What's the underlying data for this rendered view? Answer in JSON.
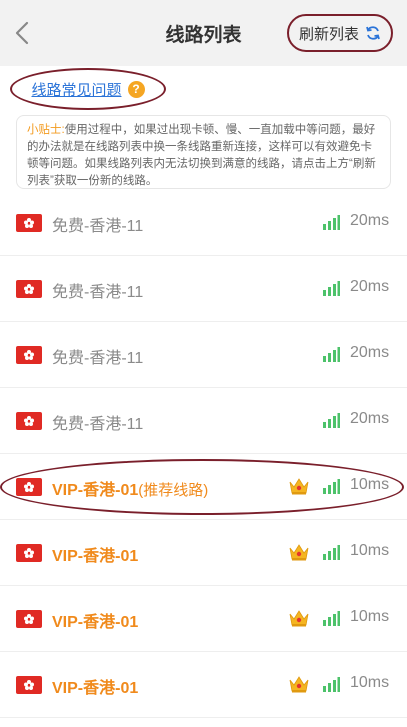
{
  "header": {
    "title": "线路列表",
    "refresh_label": "刷新列表"
  },
  "faq": {
    "label": "线路常见问题",
    "help_symbol": "?"
  },
  "tip": {
    "label": "小贴士:",
    "text": "使用过程中，如果过出现卡顿、慢、一直加载中等问题，最好的办法就是在线路列表中换一条线路重新连接，这样可以有效避免卡顿等问题。如果线路列表内无法切换到满意的线路，请点击上方“刷新列表”获取一份新的线路。"
  },
  "colors": {
    "accent_orange": "#f08a1c",
    "link_blue": "#2a73d8",
    "signal_green": "#4cc26a",
    "flag_red": "#e02a24",
    "annotation_circle": "#7a1f2b"
  },
  "lines": [
    {
      "name": "免费-香港-11",
      "latency": "20ms",
      "vip": false,
      "tag": "",
      "flag_icon": "hong-kong-flag-icon",
      "signal_icon": "signal-bars-icon"
    },
    {
      "name": "免费-香港-11",
      "latency": "20ms",
      "vip": false,
      "tag": "",
      "flag_icon": "hong-kong-flag-icon",
      "signal_icon": "signal-bars-icon"
    },
    {
      "name": "免费-香港-11",
      "latency": "20ms",
      "vip": false,
      "tag": "",
      "flag_icon": "hong-kong-flag-icon",
      "signal_icon": "signal-bars-icon"
    },
    {
      "name": "免费-香港-11",
      "latency": "20ms",
      "vip": false,
      "tag": "",
      "flag_icon": "hong-kong-flag-icon",
      "signal_icon": "signal-bars-icon"
    },
    {
      "name": "VIP-香港-01",
      "latency": "10ms",
      "vip": true,
      "tag": "(推荐线路)",
      "flag_icon": "hong-kong-flag-icon",
      "signal_icon": "signal-bars-icon",
      "crown_icon": "crown-icon"
    },
    {
      "name": "VIP-香港-01",
      "latency": "10ms",
      "vip": true,
      "tag": "",
      "flag_icon": "hong-kong-flag-icon",
      "signal_icon": "signal-bars-icon",
      "crown_icon": "crown-icon"
    },
    {
      "name": "VIP-香港-01",
      "latency": "10ms",
      "vip": true,
      "tag": "",
      "flag_icon": "hong-kong-flag-icon",
      "signal_icon": "signal-bars-icon",
      "crown_icon": "crown-icon"
    },
    {
      "name": "VIP-香港-01",
      "latency": "10ms",
      "vip": true,
      "tag": "",
      "flag_icon": "hong-kong-flag-icon",
      "signal_icon": "signal-bars-icon",
      "crown_icon": "crown-icon"
    }
  ]
}
